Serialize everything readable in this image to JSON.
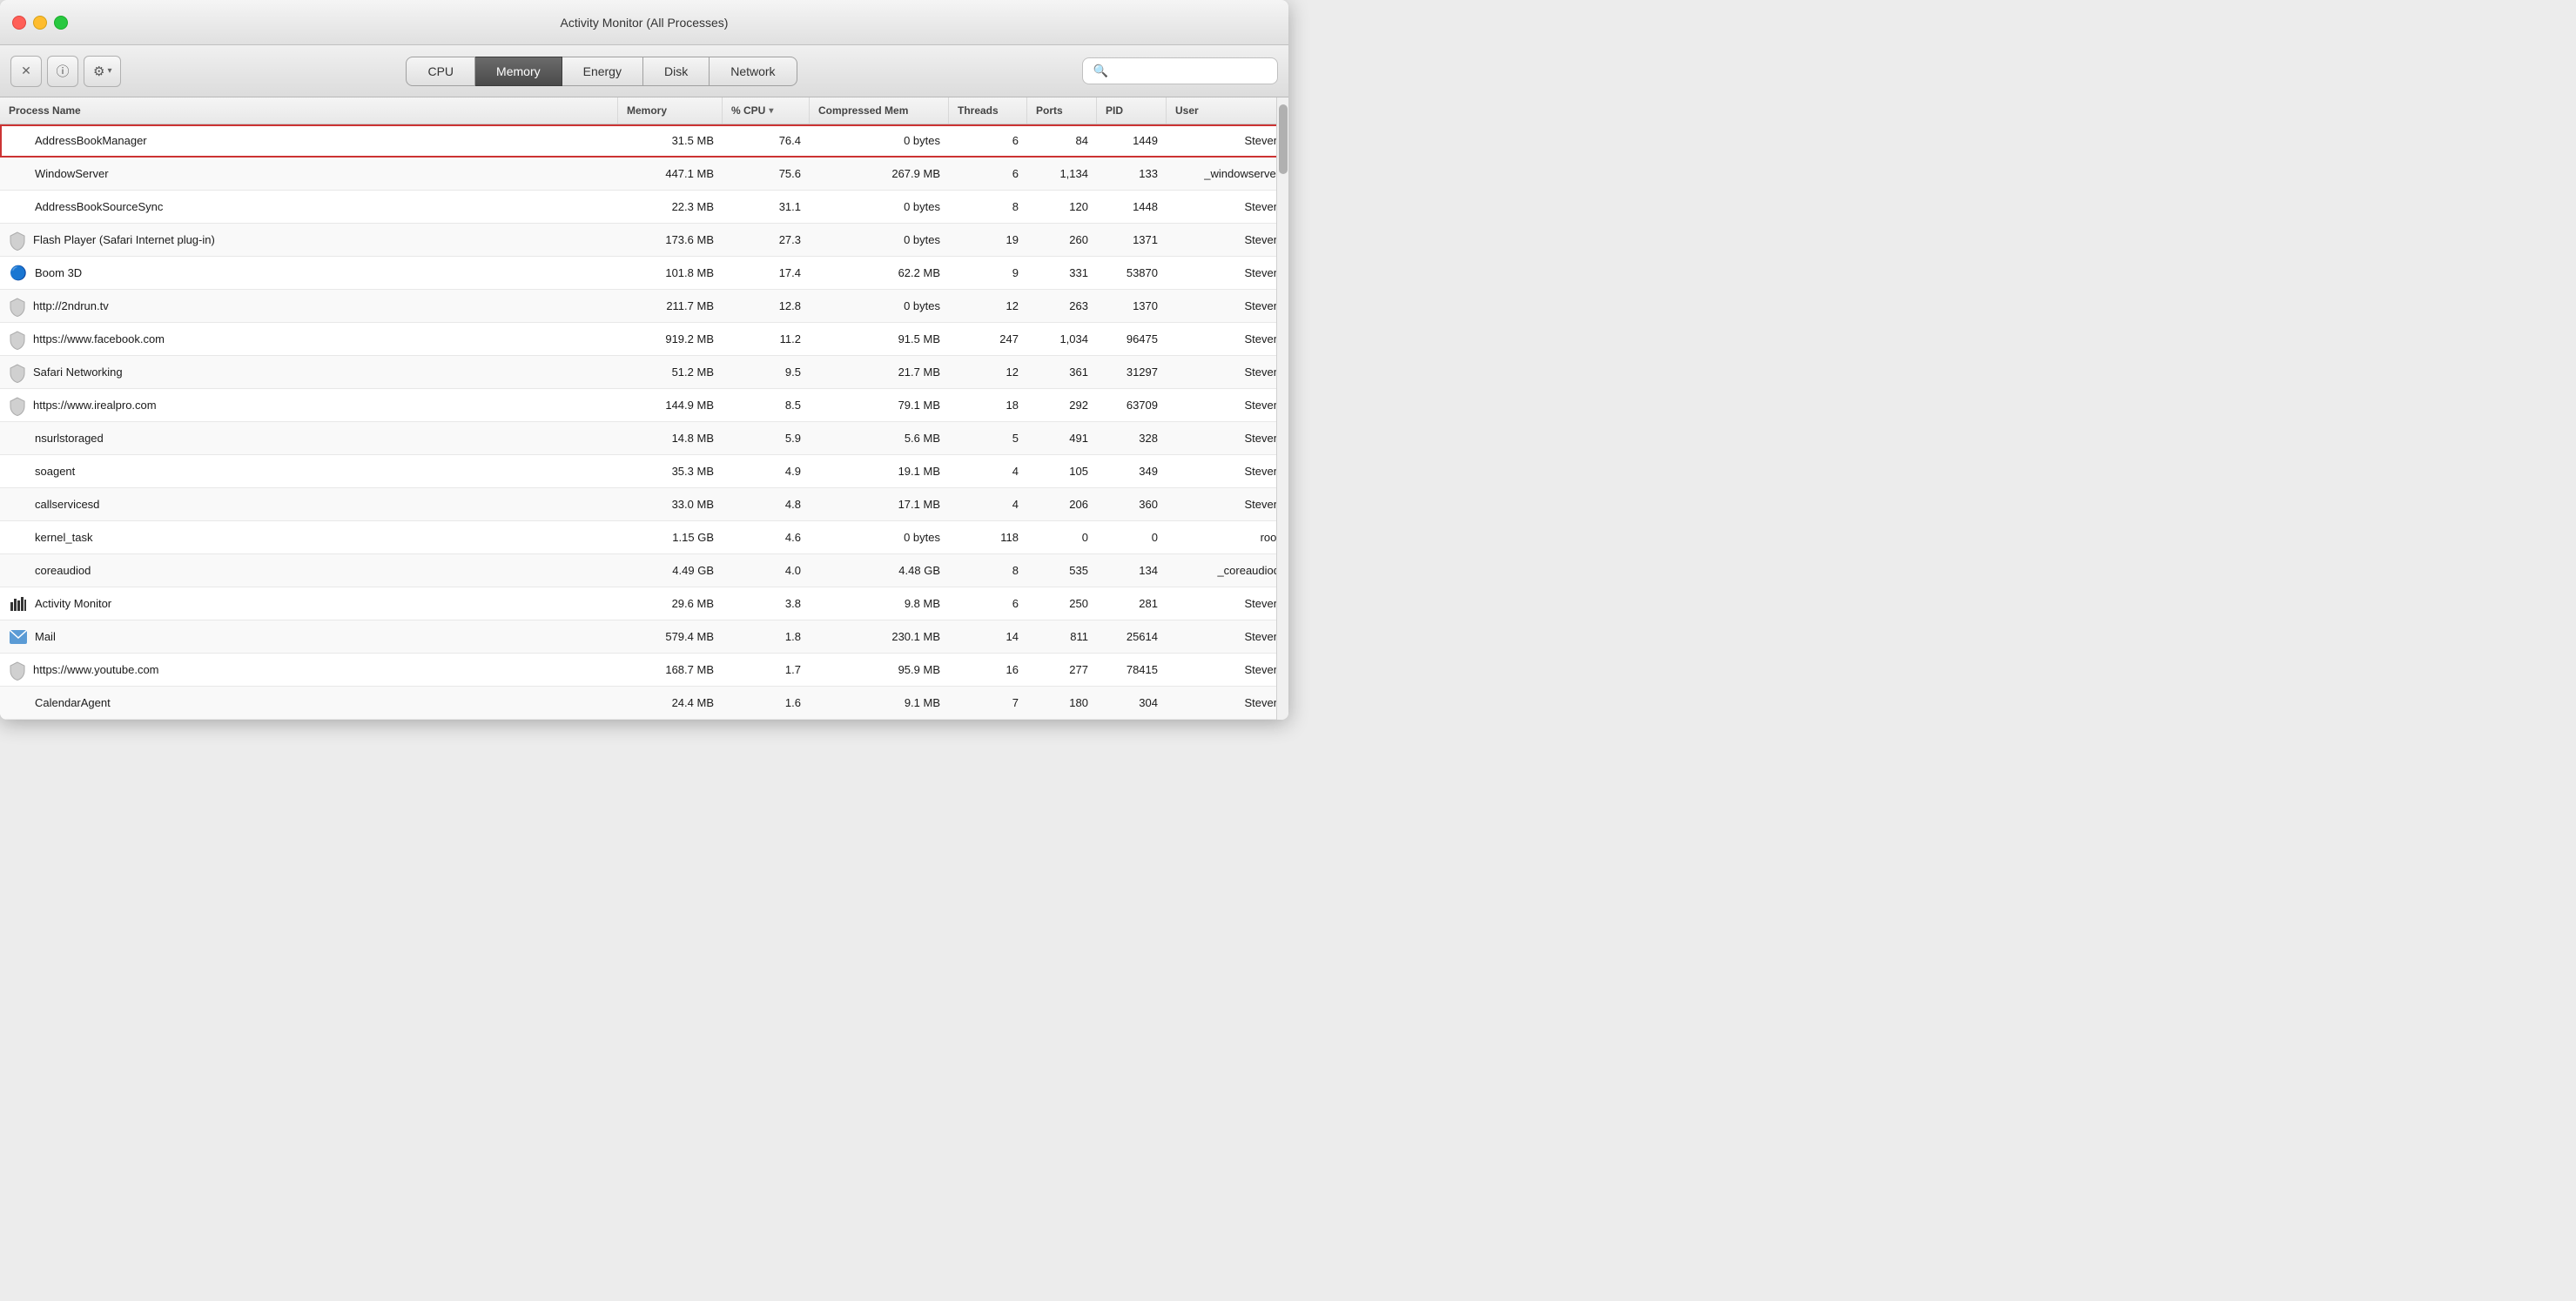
{
  "window": {
    "title": "Activity Monitor (All Processes)"
  },
  "toolbar": {
    "close_btn": "×",
    "info_btn": "ⓘ",
    "gear_btn": "⚙",
    "chevron": "▾",
    "tabs": [
      {
        "id": "cpu",
        "label": "CPU",
        "active": false
      },
      {
        "id": "memory",
        "label": "Memory",
        "active": true
      },
      {
        "id": "energy",
        "label": "Energy",
        "active": false
      },
      {
        "id": "disk",
        "label": "Disk",
        "active": false
      },
      {
        "id": "network",
        "label": "Network",
        "active": false
      }
    ],
    "search_placeholder": "Search"
  },
  "table": {
    "columns": [
      {
        "id": "process-name",
        "label": "Process Name"
      },
      {
        "id": "memory",
        "label": "Memory"
      },
      {
        "id": "cpu",
        "label": "% CPU",
        "sorted": true,
        "sort_dir": "desc"
      },
      {
        "id": "compressed-mem",
        "label": "Compressed Mem"
      },
      {
        "id": "threads",
        "label": "Threads"
      },
      {
        "id": "ports",
        "label": "Ports"
      },
      {
        "id": "pid",
        "label": "PID"
      },
      {
        "id": "user",
        "label": "User"
      }
    ],
    "rows": [
      {
        "name": "AddressBookManager",
        "icon": "",
        "icon_type": "none",
        "memory": "31.5 MB",
        "cpu": "76.4",
        "compressed": "0 bytes",
        "threads": "6",
        "ports": "84",
        "pid": "1449",
        "user": "Steven",
        "selected": true
      },
      {
        "name": "WindowServer",
        "icon": "",
        "icon_type": "none",
        "memory": "447.1 MB",
        "cpu": "75.6",
        "compressed": "267.9 MB",
        "threads": "6",
        "ports": "1,134",
        "pid": "133",
        "user": "_windowserver",
        "selected": false
      },
      {
        "name": "AddressBookSourceSync",
        "icon": "",
        "icon_type": "none",
        "memory": "22.3 MB",
        "cpu": "31.1",
        "compressed": "0 bytes",
        "threads": "8",
        "ports": "120",
        "pid": "1448",
        "user": "Steven",
        "selected": false
      },
      {
        "name": "Flash Player (Safari Internet plug-in)",
        "icon": "shield",
        "icon_type": "shield",
        "memory": "173.6 MB",
        "cpu": "27.3",
        "compressed": "0 bytes",
        "threads": "19",
        "ports": "260",
        "pid": "1371",
        "user": "Steven",
        "selected": false
      },
      {
        "name": "Boom 3D",
        "icon": "🔵",
        "icon_type": "emoji",
        "memory": "101.8 MB",
        "cpu": "17.4",
        "compressed": "62.2 MB",
        "threads": "9",
        "ports": "331",
        "pid": "53870",
        "user": "Steven",
        "selected": false
      },
      {
        "name": "http://2ndrun.tv",
        "icon": "shield",
        "icon_type": "shield",
        "memory": "211.7 MB",
        "cpu": "12.8",
        "compressed": "0 bytes",
        "threads": "12",
        "ports": "263",
        "pid": "1370",
        "user": "Steven",
        "selected": false
      },
      {
        "name": "https://www.facebook.com",
        "icon": "shield",
        "icon_type": "shield",
        "memory": "919.2 MB",
        "cpu": "11.2",
        "compressed": "91.5 MB",
        "threads": "247",
        "ports": "1,034",
        "pid": "96475",
        "user": "Steven",
        "selected": false
      },
      {
        "name": "Safari Networking",
        "icon": "shield",
        "icon_type": "shield",
        "memory": "51.2 MB",
        "cpu": "9.5",
        "compressed": "21.7 MB",
        "threads": "12",
        "ports": "361",
        "pid": "31297",
        "user": "Steven",
        "selected": false
      },
      {
        "name": "https://www.irealpro.com",
        "icon": "shield",
        "icon_type": "shield",
        "memory": "144.9 MB",
        "cpu": "8.5",
        "compressed": "79.1 MB",
        "threads": "18",
        "ports": "292",
        "pid": "63709",
        "user": "Steven",
        "selected": false
      },
      {
        "name": "nsurlstoraged",
        "icon": "",
        "icon_type": "none",
        "memory": "14.8 MB",
        "cpu": "5.9",
        "compressed": "5.6 MB",
        "threads": "5",
        "ports": "491",
        "pid": "328",
        "user": "Steven",
        "selected": false
      },
      {
        "name": "soagent",
        "icon": "",
        "icon_type": "none",
        "memory": "35.3 MB",
        "cpu": "4.9",
        "compressed": "19.1 MB",
        "threads": "4",
        "ports": "105",
        "pid": "349",
        "user": "Steven",
        "selected": false
      },
      {
        "name": "callservicesd",
        "icon": "",
        "icon_type": "none",
        "memory": "33.0 MB",
        "cpu": "4.8",
        "compressed": "17.1 MB",
        "threads": "4",
        "ports": "206",
        "pid": "360",
        "user": "Steven",
        "selected": false
      },
      {
        "name": "kernel_task",
        "icon": "",
        "icon_type": "none",
        "memory": "1.15 GB",
        "cpu": "4.6",
        "compressed": "0 bytes",
        "threads": "118",
        "ports": "0",
        "pid": "0",
        "user": "root",
        "selected": false
      },
      {
        "name": "coreaudiod",
        "icon": "",
        "icon_type": "none",
        "memory": "4.49 GB",
        "cpu": "4.0",
        "compressed": "4.48 GB",
        "threads": "8",
        "ports": "535",
        "pid": "134",
        "user": "_coreaudiod",
        "selected": false
      },
      {
        "name": "Activity Monitor",
        "icon": "📊",
        "icon_type": "emoji",
        "memory": "29.6 MB",
        "cpu": "3.8",
        "compressed": "9.8 MB",
        "threads": "6",
        "ports": "250",
        "pid": "281",
        "user": "Steven",
        "selected": false
      },
      {
        "name": "Mail",
        "icon": "✉",
        "icon_type": "emoji",
        "memory": "579.4 MB",
        "cpu": "1.8",
        "compressed": "230.1 MB",
        "threads": "14",
        "ports": "811",
        "pid": "25614",
        "user": "Steven",
        "selected": false
      },
      {
        "name": "https://www.youtube.com",
        "icon": "shield",
        "icon_type": "shield",
        "memory": "168.7 MB",
        "cpu": "1.7",
        "compressed": "95.9 MB",
        "threads": "16",
        "ports": "277",
        "pid": "78415",
        "user": "Steven",
        "selected": false
      },
      {
        "name": "CalendarAgent",
        "icon": "",
        "icon_type": "none",
        "memory": "24.4 MB",
        "cpu": "1.6",
        "compressed": "9.1 MB",
        "threads": "7",
        "ports": "180",
        "pid": "304",
        "user": "Steven",
        "selected": false
      }
    ]
  }
}
